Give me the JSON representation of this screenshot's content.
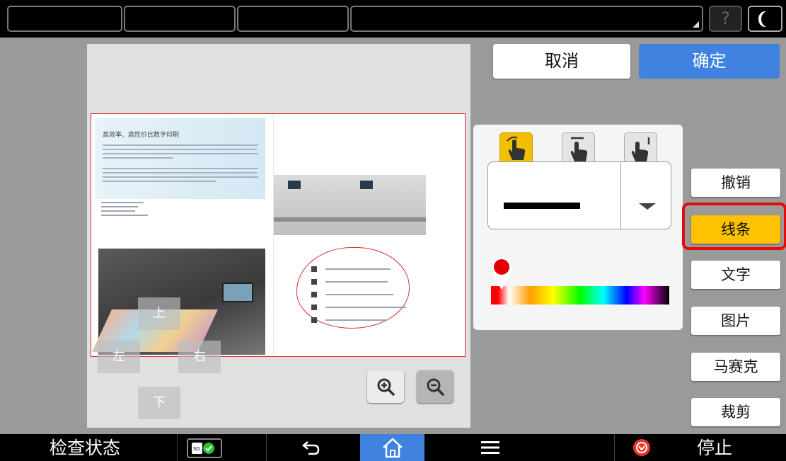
{
  "header": {
    "help_label": "?"
  },
  "preview": {
    "doc_title": "高效率、高性价比数字印刷",
    "nav": {
      "up": "上",
      "left": "左",
      "right": "右",
      "down": "下"
    }
  },
  "actions": {
    "cancel_label": "取消",
    "ok_label": "确定"
  },
  "tools": {
    "selected_mode": "draw",
    "line_color": "#ff0000"
  },
  "side_menu": {
    "undo": "撤销",
    "line": "线条",
    "text": "文字",
    "image": "图片",
    "mosaic": "马赛克",
    "crop": "裁剪"
  },
  "bottom_bar": {
    "check_status": "检查状态",
    "stop": "停止"
  },
  "colors": {
    "accent_blue": "#3f82e0",
    "selected_yellow": "#ffc200",
    "highlight_red": "#e30b0b"
  }
}
